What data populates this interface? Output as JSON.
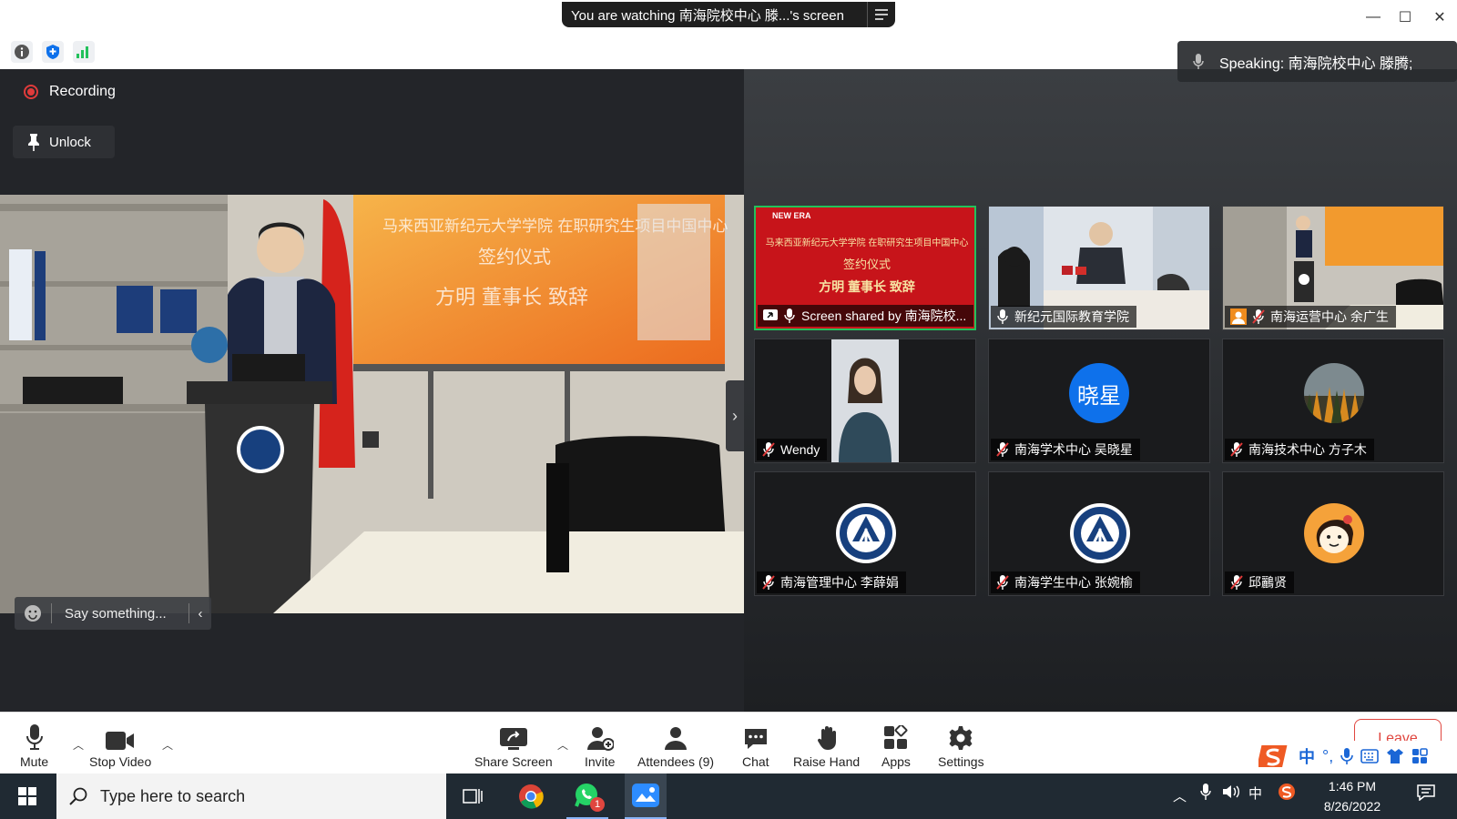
{
  "titlebar": {
    "banner_text": "You are watching 南海院校中心 滕...'s screen",
    "minimize": "—",
    "maximize": "☐",
    "close": "✕"
  },
  "speaking": {
    "text": "Speaking: 南海院校中心 滕腾;"
  },
  "recording": {
    "label": "Recording"
  },
  "unlock": {
    "label": "Unlock"
  },
  "main_video": {
    "slide_line1": "马来西亚新纪元大学学院 在职研究生项目中国中心",
    "slide_line2": "签约仪式",
    "slide_line3": "方明 董事长 致辞"
  },
  "chat_input": {
    "placeholder": "Say something..."
  },
  "gallery": [
    {
      "name": "Screen shared by 南海院校...",
      "type": "screen",
      "slide_brand": "NEW ERA",
      "slide_line1": "马来西亚新纪元大学学院 在职研究生项目中国中心",
      "slide_line2": "签约仪式",
      "slide_line3": "方明 董事长 致辞"
    },
    {
      "name": "新纪元国际教育学院",
      "type": "video-office"
    },
    {
      "name": "南海运营中心 余广生",
      "type": "video-room"
    },
    {
      "name": "Wendy",
      "type": "video-person"
    },
    {
      "name": "南海学术中心 吴晓星",
      "type": "avatar-text",
      "avatar_text": "晓星",
      "avatar_color": "#0e71eb"
    },
    {
      "name": "南海技术中心 方子木",
      "type": "avatar-forest"
    },
    {
      "name": "南海管理中心 李薛娟",
      "type": "logo"
    },
    {
      "name": "南海学生中心 张婉榆",
      "type": "logo"
    },
    {
      "name": "邱鸝贤",
      "type": "avatar-cartoon"
    }
  ],
  "toolbar": {
    "mute": "Mute",
    "stop_video": "Stop Video",
    "share_screen": "Share Screen",
    "invite": "Invite",
    "attendees": "Attendees (9)",
    "chat": "Chat",
    "raise_hand": "Raise Hand",
    "apps": "Apps",
    "settings": "Settings",
    "leave": "Leave"
  },
  "ime": {
    "lang": "中"
  },
  "taskbar": {
    "search_placeholder": "Type here to search",
    "whatsapp_badge": "1",
    "tray_lang": "中",
    "time": "1:46 PM",
    "date": "8/26/2022"
  },
  "colors": {
    "accent": "#0e71eb",
    "record_red": "#e03b3b",
    "active_green": "#23c15b",
    "leave_red": "#e0463f"
  }
}
